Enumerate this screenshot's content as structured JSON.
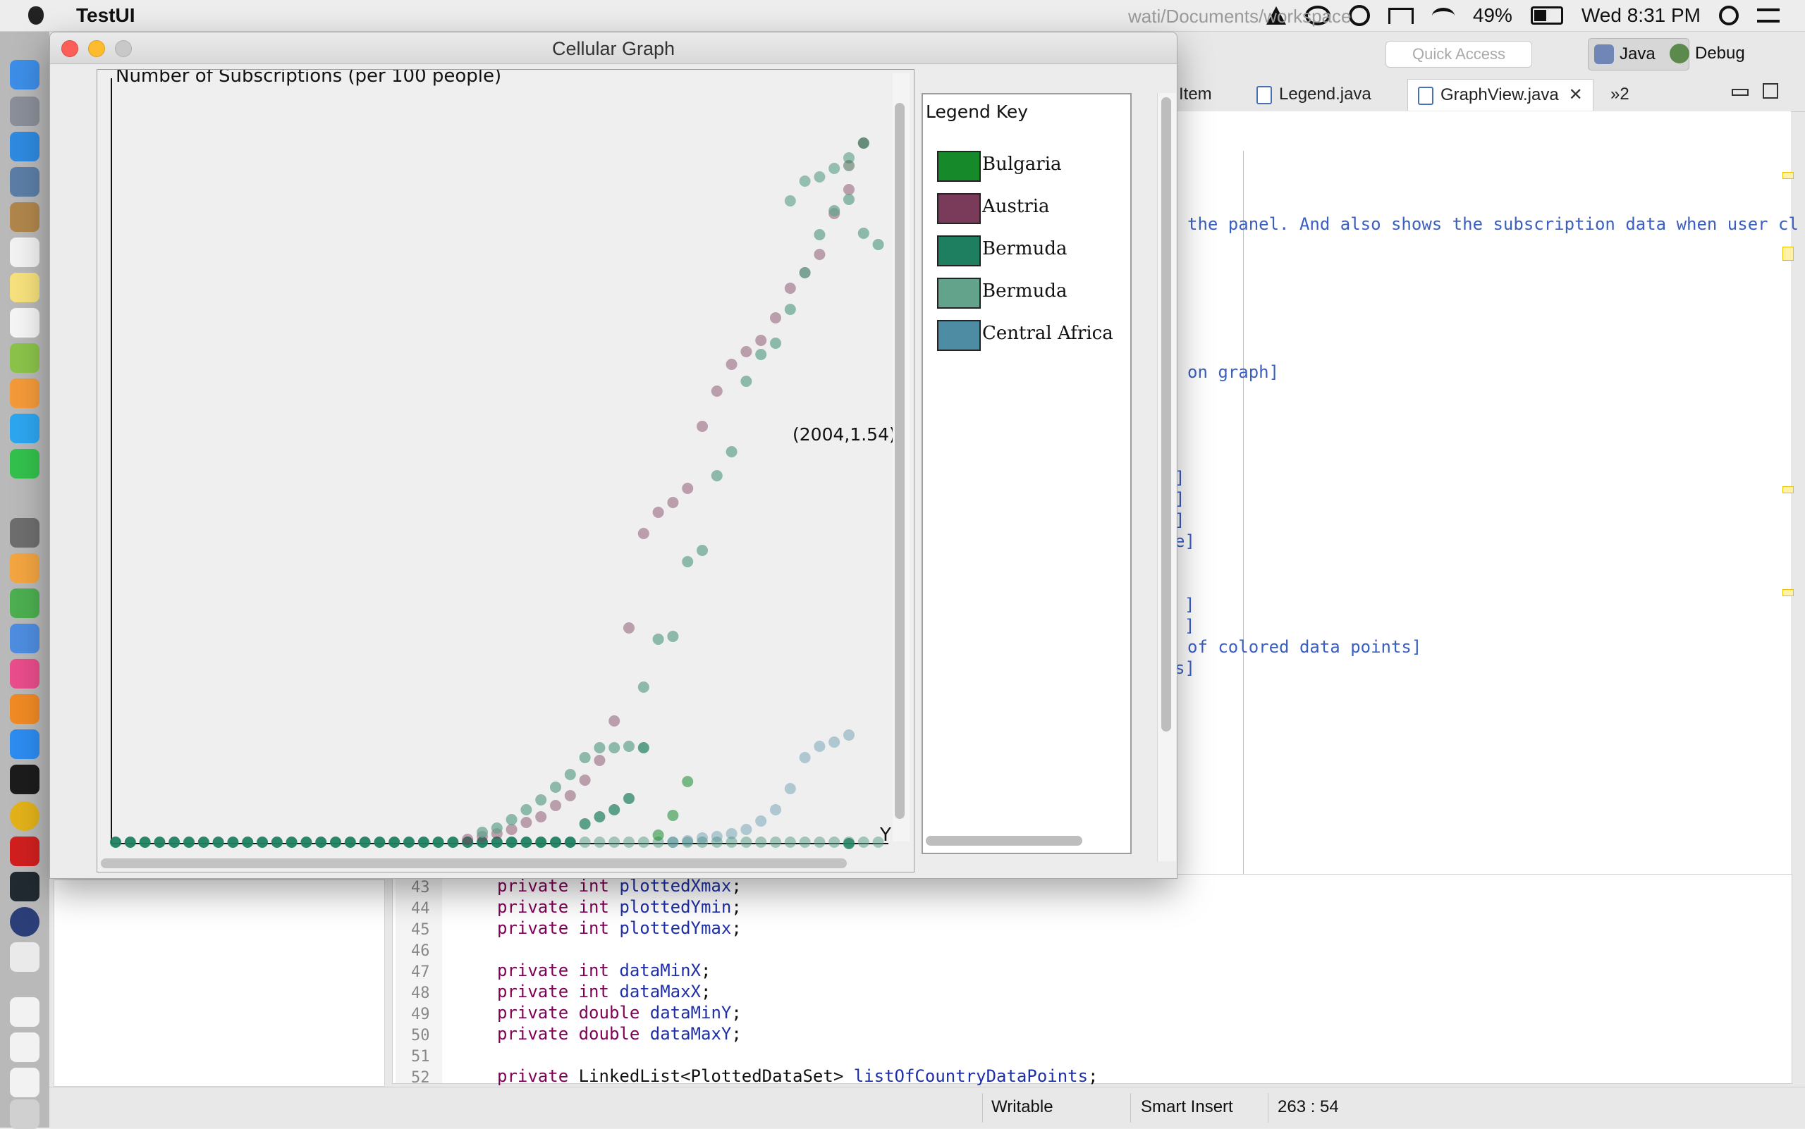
{
  "menubar": {
    "app_name": "TestUI",
    "battery_percent": "49%",
    "battery_level": 0.49,
    "clock": "Wed 8:31 PM"
  },
  "eclipse": {
    "path": "wati/Documents/workspace",
    "quick_access": "Quick Access",
    "perspectives": {
      "java": "Java",
      "debug": "Debug"
    },
    "tabs": {
      "item": "Item",
      "legend": "Legend.java",
      "graphview": "GraphView.java",
      "overflow": "»2"
    },
    "code_fragments": [
      "the panel. And also shows the subscription data when user cl",
      "on graph]",
      "]",
      "]",
      "]",
      "e]",
      "]",
      "]",
      "of colored data points]",
      "s]"
    ],
    "code_lines": [
      {
        "num": "43",
        "kw": "private int ",
        "name": "plottedXmax",
        "end": ";"
      },
      {
        "num": "44",
        "kw": "private int ",
        "name": "plottedYmin",
        "end": ";"
      },
      {
        "num": "45",
        "kw": "private int ",
        "name": "plottedYmax",
        "end": ";"
      },
      {
        "num": "46",
        "kw": "",
        "name": "",
        "end": ""
      },
      {
        "num": "47",
        "kw": "private int ",
        "name": "dataMinX",
        "end": ";"
      },
      {
        "num": "48",
        "kw": "private int ",
        "name": "dataMaxX",
        "end": ";"
      },
      {
        "num": "49",
        "kw": "private double ",
        "name": "dataMinY",
        "end": ";"
      },
      {
        "num": "50",
        "kw": "private double ",
        "name": "dataMaxY",
        "end": ";"
      },
      {
        "num": "51",
        "kw": "",
        "name": "",
        "end": ""
      },
      {
        "num": "52",
        "kw": "private ",
        "type": "LinkedList<PlottedDataSet> ",
        "name": "listOfCountryDataPoints",
        "end": ";"
      }
    ],
    "status": {
      "writable": "Writable",
      "insert_mode": "Smart Insert",
      "position": "263 : 54"
    }
  },
  "window": {
    "title": "Cellular Graph"
  },
  "chart_data": {
    "type": "scatter",
    "ylabel": "Number of Subscriptions (per 100 people)",
    "xlabel": "Y",
    "tooltip": "(2004,1.54)",
    "legend_title": "Legend Key",
    "legend_placement": "right",
    "grid": false,
    "series": [
      {
        "name": "Bulgaria",
        "color": "#168a2b"
      },
      {
        "name": "Austria",
        "color": "#7a3b5a"
      },
      {
        "name": "Bermuda",
        "color": "#1e7f60"
      },
      {
        "name": "Bermuda",
        "color": "#63a38c"
      },
      {
        "name": "Central Africa",
        "color": "#4d8ca3"
      }
    ]
  }
}
